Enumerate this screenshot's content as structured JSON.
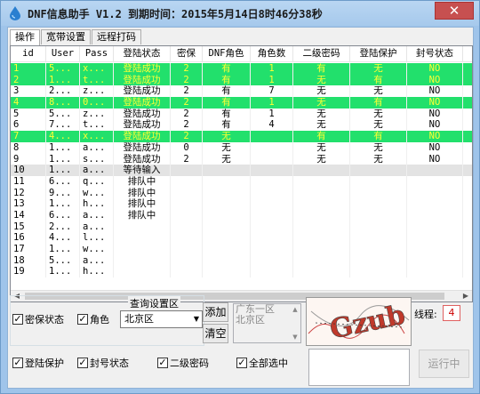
{
  "window": {
    "title": "DNF信息助手 V1.2  到期时间：2015年5月14日8时46分38秒",
    "close_symbol": "✕"
  },
  "tabs": [
    "操作",
    "宽带设置",
    "远程打码"
  ],
  "table": {
    "columns": [
      "id",
      "User",
      "Pass",
      "登陆状态",
      "密保",
      "DNF角色",
      "角色数",
      "二级密码",
      "登陆保护",
      "封号状态"
    ],
    "rows": [
      {
        "id": "1",
        "user": "5...",
        "pass": "x...",
        "status": "登陆成功",
        "mibao": "2",
        "role": "有",
        "count": "1",
        "pw2": "有",
        "protect": "无",
        "ban": "NO",
        "hl": "green"
      },
      {
        "id": "2",
        "user": "1...",
        "pass": "t...",
        "status": "登陆成功",
        "mibao": "2",
        "role": "有",
        "count": "1",
        "pw2": "无",
        "protect": "有",
        "ban": "NO",
        "hl": "green"
      },
      {
        "id": "3",
        "user": "2...",
        "pass": "z...",
        "status": "登陆成功",
        "mibao": "2",
        "role": "有",
        "count": "7",
        "pw2": "无",
        "protect": "无",
        "ban": "NO",
        "hl": ""
      },
      {
        "id": "4",
        "user": "8...",
        "pass": "0...",
        "status": "登陆成功",
        "mibao": "2",
        "role": "有",
        "count": "1",
        "pw2": "无",
        "protect": "有",
        "ban": "NO",
        "hl": "green"
      },
      {
        "id": "5",
        "user": "5...",
        "pass": "z...",
        "status": "登陆成功",
        "mibao": "2",
        "role": "有",
        "count": "1",
        "pw2": "无",
        "protect": "无",
        "ban": "NO",
        "hl": ""
      },
      {
        "id": "6",
        "user": "7...",
        "pass": "t...",
        "status": "登陆成功",
        "mibao": "2",
        "role": "有",
        "count": "4",
        "pw2": "无",
        "protect": "无",
        "ban": "NO",
        "hl": ""
      },
      {
        "id": "7",
        "user": "4...",
        "pass": "x...",
        "status": "登陆成功",
        "mibao": "2",
        "role": "无",
        "count": "",
        "pw2": "有",
        "protect": "有",
        "ban": "NO",
        "hl": "green"
      },
      {
        "id": "8",
        "user": "1...",
        "pass": "a...",
        "status": "登陆成功",
        "mibao": "0",
        "role": "无",
        "count": "",
        "pw2": "无",
        "protect": "无",
        "ban": "NO",
        "hl": ""
      },
      {
        "id": "9",
        "user": "1...",
        "pass": "s...",
        "status": "登陆成功",
        "mibao": "2",
        "role": "无",
        "count": "",
        "pw2": "无",
        "protect": "无",
        "ban": "NO",
        "hl": ""
      },
      {
        "id": "10",
        "user": "1...",
        "pass": "a...",
        "status": "等待输入",
        "mibao": "",
        "role": "",
        "count": "",
        "pw2": "",
        "protect": "",
        "ban": "",
        "hl": "gray"
      },
      {
        "id": "11",
        "user": "6...",
        "pass": "q...",
        "status": "排队中",
        "mibao": "",
        "role": "",
        "count": "",
        "pw2": "",
        "protect": "",
        "ban": "",
        "hl": ""
      },
      {
        "id": "12",
        "user": "9...",
        "pass": "w...",
        "status": "排队中",
        "mibao": "",
        "role": "",
        "count": "",
        "pw2": "",
        "protect": "",
        "ban": "",
        "hl": ""
      },
      {
        "id": "13",
        "user": "1...",
        "pass": "h...",
        "status": "排队中",
        "mibao": "",
        "role": "",
        "count": "",
        "pw2": "",
        "protect": "",
        "ban": "",
        "hl": ""
      },
      {
        "id": "14",
        "user": "6...",
        "pass": "a...",
        "status": "排队中",
        "mibao": "",
        "role": "",
        "count": "",
        "pw2": "",
        "protect": "",
        "ban": "",
        "hl": ""
      },
      {
        "id": "15",
        "user": "2...",
        "pass": "a...",
        "status": "",
        "mibao": "",
        "role": "",
        "count": "",
        "pw2": "",
        "protect": "",
        "ban": "",
        "hl": ""
      },
      {
        "id": "16",
        "user": "4...",
        "pass": "l...",
        "status": "",
        "mibao": "",
        "role": "",
        "count": "",
        "pw2": "",
        "protect": "",
        "ban": "",
        "hl": ""
      },
      {
        "id": "17",
        "user": "1...",
        "pass": "w...",
        "status": "",
        "mibao": "",
        "role": "",
        "count": "",
        "pw2": "",
        "protect": "",
        "ban": "",
        "hl": ""
      },
      {
        "id": "18",
        "user": "5...",
        "pass": "a...",
        "status": "",
        "mibao": "",
        "role": "",
        "count": "",
        "pw2": "",
        "protect": "",
        "ban": "",
        "hl": ""
      },
      {
        "id": "19",
        "user": "1...",
        "pass": "h...",
        "status": "",
        "mibao": "",
        "role": "",
        "count": "",
        "pw2": "",
        "protect": "",
        "ban": "",
        "hl": ""
      }
    ]
  },
  "query": {
    "group_title": "查询设置区",
    "chk_mibao": "密保状态",
    "chk_role": "角色",
    "chk_login_protect": "登陆保护",
    "chk_ban": "封号状态",
    "chk_pw2": "二级密码",
    "chk_all": "全部选中",
    "check_mark": "✓",
    "region_select": "北京区",
    "add_label": "添加",
    "clear_label": "清空",
    "listbox_items": [
      "广东一区",
      "北京区"
    ]
  },
  "thread_label": "线程:",
  "thread_value": "4",
  "run_label": "运行中",
  "captcha_text": "Gzub",
  "colors": {
    "highlight_row": "#22e06c",
    "highlight_text": "#ffff33"
  }
}
